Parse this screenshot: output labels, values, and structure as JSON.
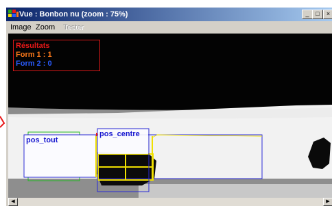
{
  "window": {
    "title": "Vue : Bonbon nu (zoom : 75%)",
    "controls": {
      "minimize": "_",
      "maximize": "□",
      "close": "×"
    }
  },
  "menu": {
    "items": [
      {
        "label": "Image",
        "enabled": true
      },
      {
        "label": "Zoom",
        "enabled": true
      },
      {
        "label": "Tester",
        "enabled": false
      }
    ]
  },
  "results_panel": {
    "heading": "Résultats",
    "form1": "Form 1 : 1",
    "form2": "Form 2 : 0",
    "colors": {
      "heading": "#e81818",
      "form1": "#ff7a1a",
      "form2": "#2a5cff",
      "border": "#d81818"
    }
  },
  "regions": {
    "pos_tout": "pos_tout",
    "pos_centre": "pos_centre"
  },
  "colors": {
    "region_outline": "#2b2bd6",
    "centre_guides": "#f0e000",
    "lower_guide": "#22b822",
    "marker": "#e81818"
  },
  "icons": {
    "app": "app-icon",
    "scroll_left": "arrow-left-icon",
    "scroll_right": "arrow-right-icon"
  }
}
